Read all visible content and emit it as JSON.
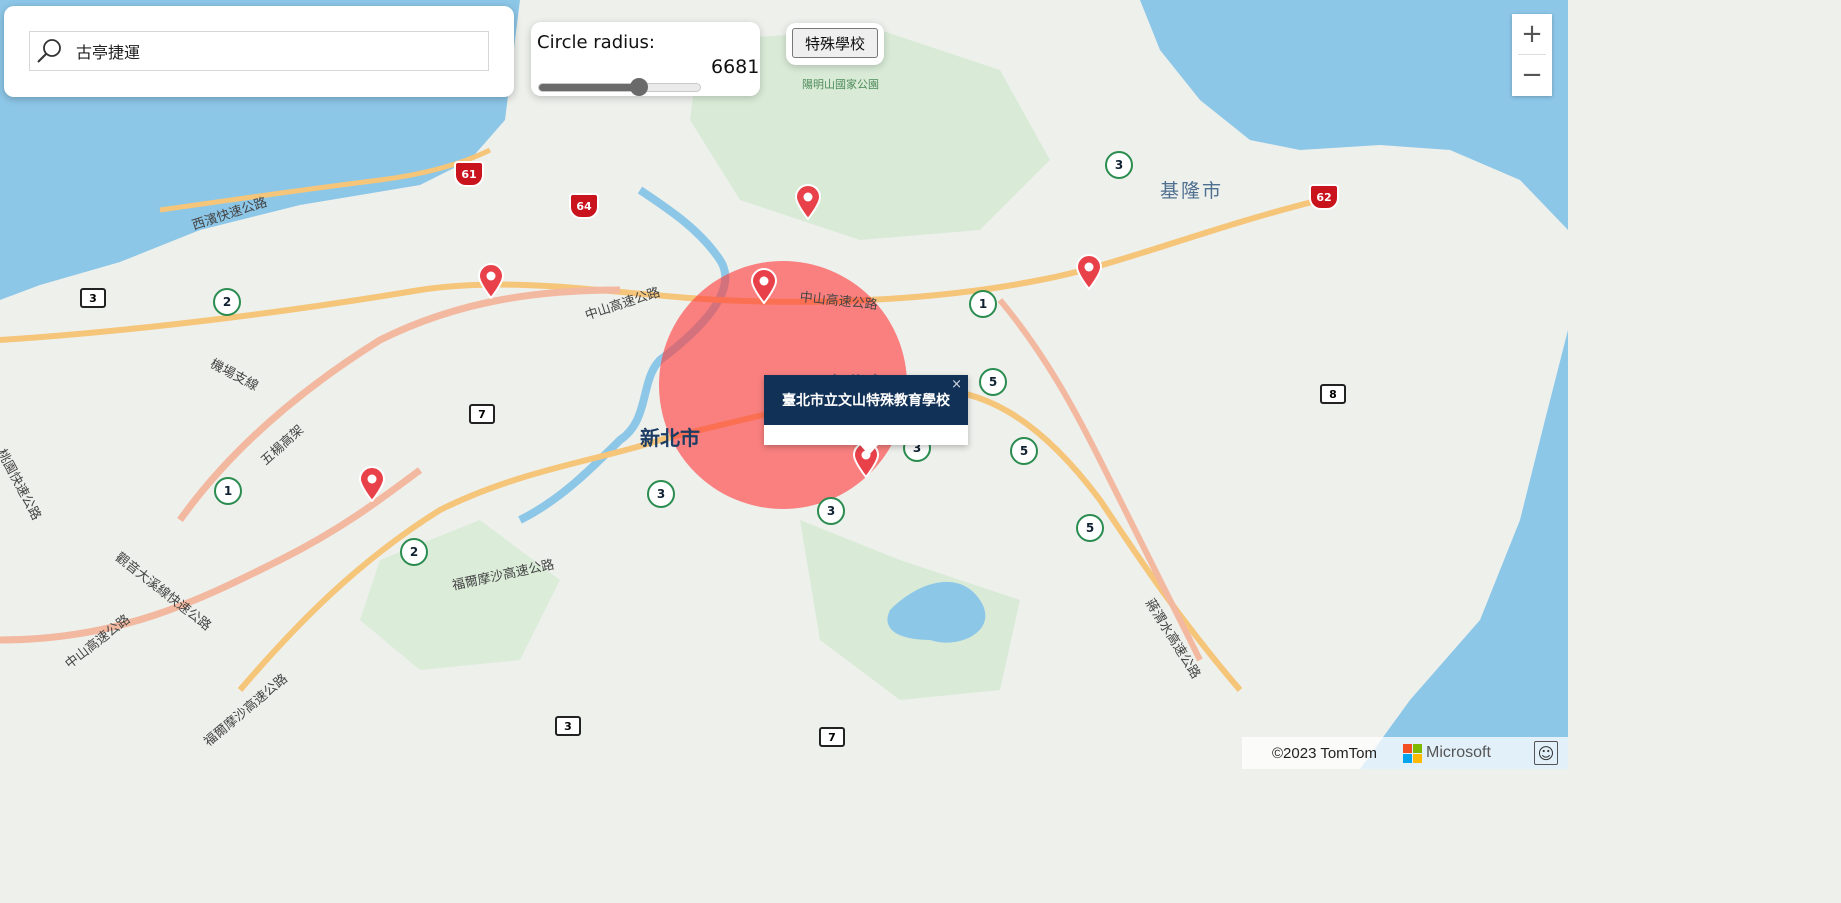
{
  "search": {
    "value": "古亭捷運",
    "placeholder": ""
  },
  "radius_control": {
    "label": "Circle radius:",
    "value": "6681",
    "fraction": 0.62
  },
  "special_school_button": {
    "label": "特殊學校"
  },
  "zoom": {
    "in_label": "+",
    "out_label": "−"
  },
  "popup": {
    "title": "臺北市立文山特殊教育學校",
    "close_label": "×"
  },
  "map_labels": {
    "new_taipei": "新北市",
    "taipei": "台北市",
    "keelung": "基隆市",
    "yangmingshan": "陽明山國家公園",
    "west_coast_expressway": "西濱快速公路",
    "zhongshan_hwy_1": "中山高速公路",
    "zhongshan_hwy_2": "中山高速公路",
    "zhongshan_hwy_3": "中山高速公路",
    "airport_branch": "機場支線",
    "wuyang_viaduct": "五楊高架",
    "guanyin_dadong_expressway": "觀音大溪線快速公路",
    "formosa_freeway_1": "福爾摩沙高速公路",
    "formosa_freeway_2": "福爾摩沙高速公路",
    "jiangsu_expressway": "蔣渭水高速公路",
    "taoyuan_expressway": "桃園快速公路"
  },
  "route_shields": {
    "r61": "61",
    "r64": "64",
    "r62": "62",
    "n3_a": "3",
    "n3_b": "3",
    "n3_c": "3",
    "n3_d": "3",
    "n3_e": "3",
    "n2_a": "2",
    "n2_b": "2",
    "n1_a": "1",
    "n1_b": "1",
    "n5_a": "5",
    "n5_b": "5",
    "n5_c": "5",
    "p3_a": "3",
    "p3_b": "3",
    "p7_a": "7",
    "p7_b": "7",
    "p8": "8"
  },
  "attribution": {
    "copyright": "©2023 TomTom",
    "brand": "Microsoft",
    "feedback": "☺"
  },
  "colors": {
    "circle": "#ff3b3b",
    "pin": "#e8414a",
    "popup_header": "#123157",
    "water": "#8dc7e8",
    "land": "#eef0ec"
  }
}
